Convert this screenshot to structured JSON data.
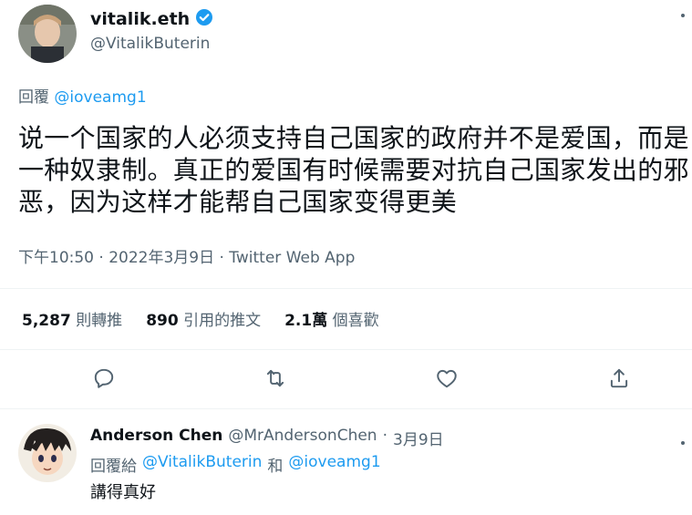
{
  "tweet": {
    "author_name": "vitalik.eth",
    "author_handle": "@VitalikButerin",
    "reply_prefix": "回覆",
    "reply_to": "@ioveamg1",
    "body": "说一个国家的人必须支持自己国家的政府并不是爱国，而是一种奴隶制。真正的爱国有时候需要对抗自己国家发出的邪恶，因为这样才能帮自己国家变得更美",
    "timestamp": "下午10:50 · 2022年3月9日 · Twitter Web App",
    "more_icon": "more-icon"
  },
  "stats": {
    "retweets_count": "5,287",
    "retweets_label": "則轉推",
    "quotes_count": "890",
    "quotes_label": "引用的推文",
    "likes_count": "2.1萬",
    "likes_label": "個喜歡"
  },
  "actions": [
    "reply-icon",
    "retweet-icon",
    "like-icon",
    "share-icon"
  ],
  "reply": {
    "author_name": "Anderson Chen",
    "author_handle": "@MrAndersonChen",
    "separator": "·",
    "date": "3月9日",
    "reply_prefix": "回覆給",
    "reply_to_1": "@VitalikButerin",
    "conjunction": "和",
    "reply_to_2": "@ioveamg1",
    "body": "講得真好"
  },
  "colors": {
    "accent": "#1d9bf0",
    "text": "#0f1419",
    "muted": "#536471",
    "divider": "#eff3f4"
  }
}
